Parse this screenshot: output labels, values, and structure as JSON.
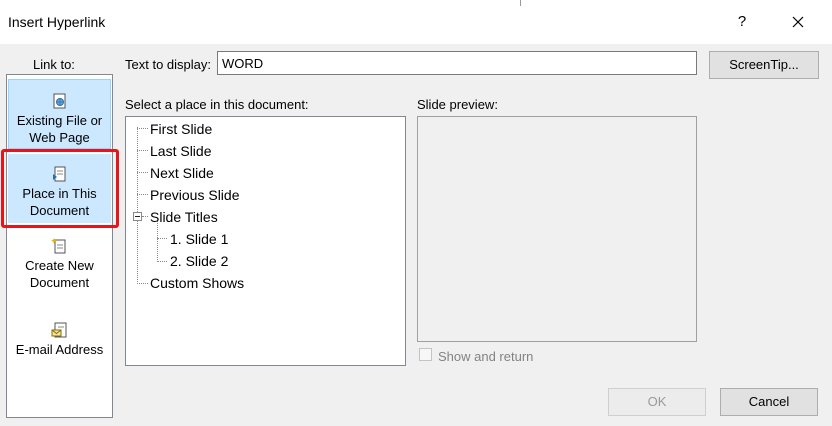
{
  "dialog": {
    "title": "Insert Hyperlink",
    "help": "?"
  },
  "link_to": {
    "label": "Link to:",
    "items": [
      {
        "line1": "Existing File or",
        "line2": "Web Page",
        "icon": "existing-file-icon",
        "selected": false
      },
      {
        "line1": "Place in This",
        "line2": "Document",
        "icon": "place-in-document-icon",
        "selected": true
      },
      {
        "line1": "Create New",
        "line2": "Document",
        "icon": "create-new-document-icon",
        "selected": false
      },
      {
        "line1": "E-mail Address",
        "line2": "",
        "icon": "email-address-icon",
        "selected": false
      }
    ]
  },
  "text_to_display": {
    "label": "Text to display:",
    "value": "WORD"
  },
  "screentip_label": "ScreenTip...",
  "place": {
    "label": "Select a place in this document:",
    "items": [
      "First Slide",
      "Last Slide",
      "Next Slide",
      "Previous Slide",
      "Slide Titles",
      "1. Slide 1",
      "2. Slide 2",
      "Custom Shows"
    ]
  },
  "preview": {
    "label": "Slide preview:",
    "show_and_return": "Show and return",
    "show_and_return_checked": false
  },
  "buttons": {
    "ok": "OK",
    "cancel": "Cancel"
  },
  "colors": {
    "selected_bg": "#cce8ff",
    "highlight_box": "#e3171b"
  }
}
